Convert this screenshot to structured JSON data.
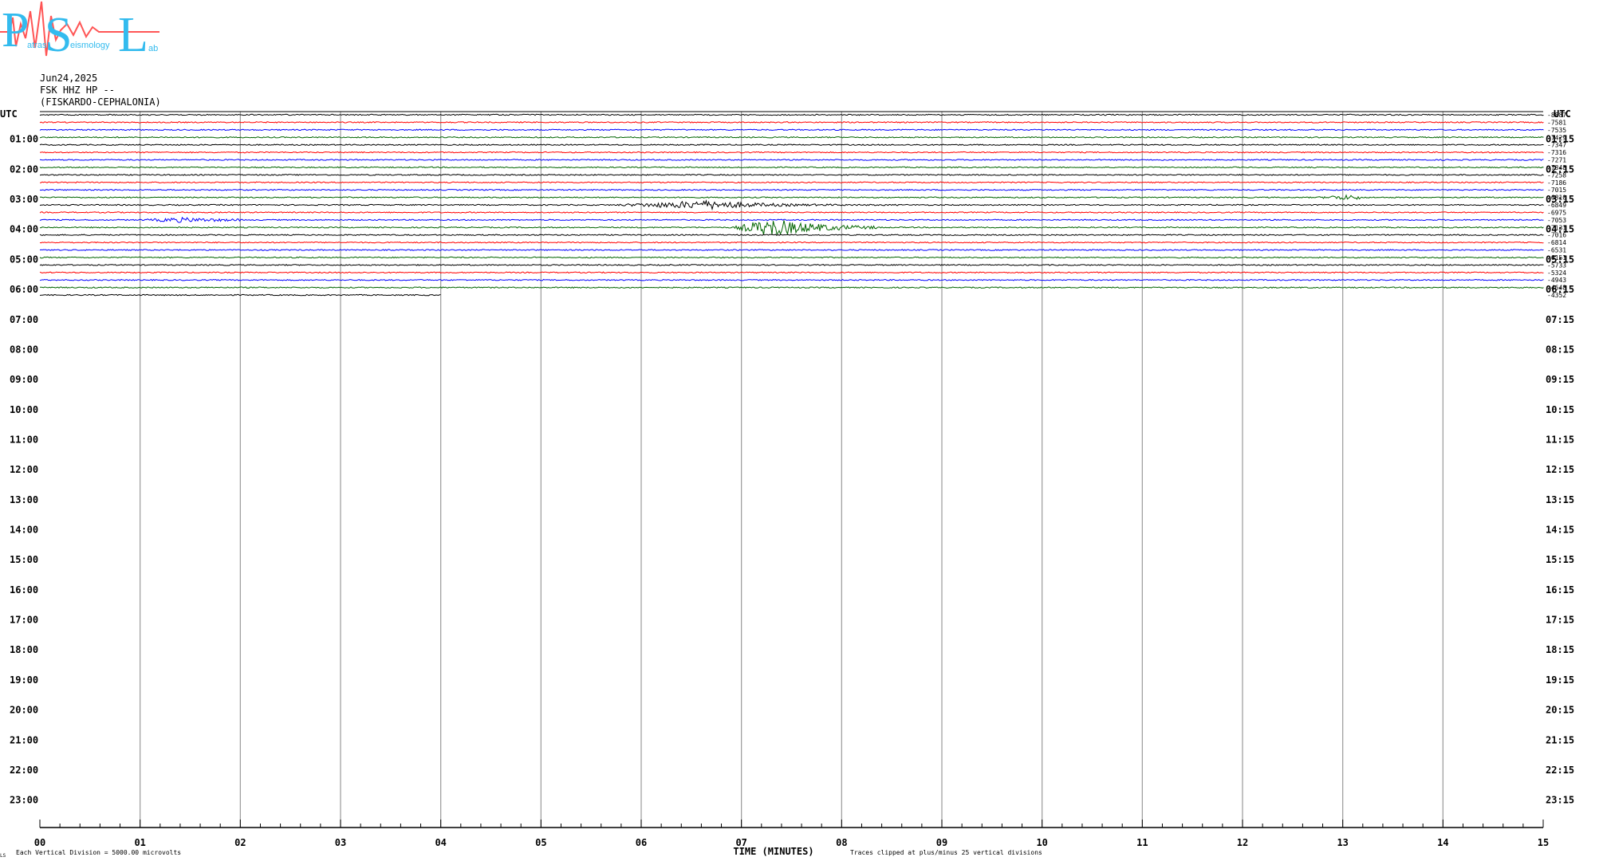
{
  "header": {
    "logo_big": [
      "P",
      "S",
      "L"
    ],
    "logo_small": [
      "atras",
      "eismology",
      "ab"
    ],
    "date": "Jun24,2025",
    "station": "FSK HHZ HP --",
    "location": "(FISKARDO-CEPHALONIA)"
  },
  "chart_data": {
    "type": "line",
    "title": "",
    "xlabel": "TIME (MINUTES)",
    "xlim": [
      0,
      15
    ],
    "x_ticks": [
      "00",
      "01",
      "02",
      "03",
      "04",
      "05",
      "06",
      "07",
      "08",
      "09",
      "10",
      "11",
      "12",
      "13",
      "14",
      "15"
    ],
    "left_axis_title": "UTC",
    "right_axis_title": "UTC",
    "left_hour_labels": [
      "01:00",
      "02:00",
      "03:00",
      "04:00",
      "05:00",
      "06:00",
      "07:00",
      "08:00",
      "09:00",
      "10:00",
      "11:00",
      "12:00",
      "13:00",
      "14:00",
      "15:00",
      "16:00",
      "17:00",
      "18:00",
      "19:00",
      "20:00",
      "21:00",
      "22:00",
      "23:00"
    ],
    "right_hour_labels": [
      "01:15",
      "02:15",
      "03:15",
      "04:15",
      "05:15",
      "06:15",
      "07:15",
      "08:15",
      "09:15",
      "10:15",
      "11:15",
      "12:15",
      "13:15",
      "14:15",
      "15:15",
      "16:15",
      "17:15",
      "18:15",
      "19:15",
      "20:15",
      "21:15",
      "22:15",
      "23:15"
    ],
    "trace_colors": [
      "#000000",
      "#ff0000",
      "#0000ff",
      "#006400"
    ],
    "trace_offsets": [
      "-8887",
      "-7581",
      "-7535",
      "-7429",
      "-7347",
      "-7316",
      "-7271",
      "-7348",
      "-7258",
      "-7186",
      "-7015",
      "-6810",
      "-6849",
      "-6975",
      "-7053",
      "-7131",
      "-7016",
      "-6814",
      "-6531",
      "-6151",
      "-5733",
      "-5324",
      "-4943",
      "-4648",
      "-4352"
    ],
    "traces_recorded": 25,
    "last_trace_extent_minutes": 4,
    "events": [
      {
        "trace": 12,
        "start_minute": 5.7,
        "end_minute": 8.6,
        "peak_minute": 6.7,
        "amplitude": "medium"
      },
      {
        "trace": 15,
        "start_minute": 6.9,
        "end_minute": 8.4,
        "peak_minute": 7.3,
        "amplitude": "large"
      },
      {
        "trace": 11,
        "start_minute": 12.75,
        "end_minute": 13.2,
        "peak_minute": 13.0,
        "amplitude": "small"
      },
      {
        "trace": 14,
        "start_minute": 1.0,
        "end_minute": 2.0,
        "peak_minute": 1.4,
        "amplitude": "small"
      }
    ],
    "footer_left": "Each Vertical Division = 5000.00 microvolts",
    "footer_right": "Traces clipped at plus/minus 25 vertical divisions",
    "corner_mark": "LS"
  }
}
